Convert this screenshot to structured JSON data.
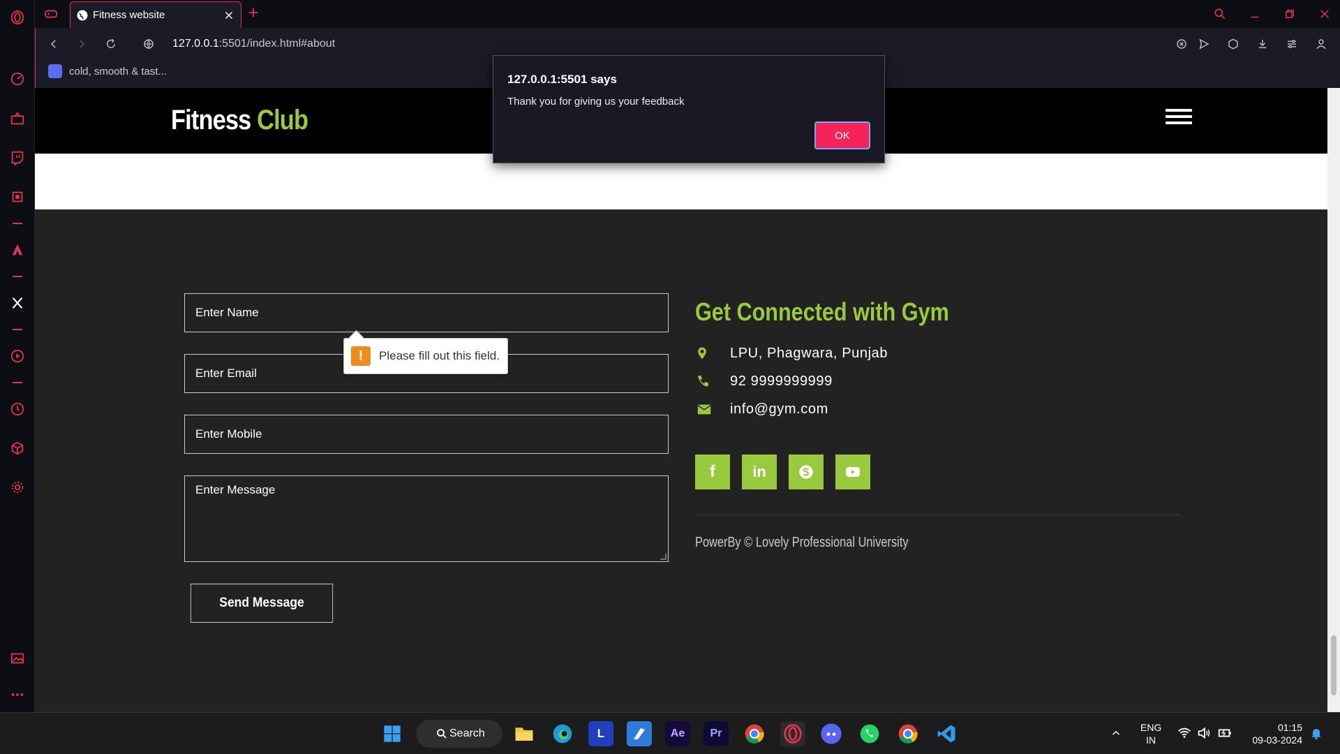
{
  "browser": {
    "tab_title": "Fitness website",
    "url_host": "127.0.0.1",
    "url_rest": ":5501/index.html#about",
    "bookmark_label": "cold, smooth & tast..."
  },
  "site": {
    "logo_part1": "Fitness ",
    "logo_part2": "Club",
    "form": {
      "name_placeholder": "Enter Name",
      "email_placeholder": "Enter Email",
      "mobile_placeholder": "Enter Mobile",
      "message_placeholder": "Enter Message",
      "send_label": "Send Message"
    },
    "validation_tooltip": "Please fill out this field.",
    "info": {
      "title": "Get Connected with Gym",
      "address": "LPU, Phagwara, Punjab",
      "phone": "92 9999999999",
      "email": "info@gym.com"
    },
    "socials": [
      "facebook",
      "linkedin",
      "skype",
      "youtube"
    ],
    "copyright": "PowerBy © Lovely Professional University"
  },
  "dialog": {
    "title": "127.0.0.1:5501 says",
    "message": "Thank you for giving us your feedback",
    "ok_label": "OK"
  },
  "taskbar": {
    "search_label": "Search",
    "lang_top": "ENG",
    "lang_bottom": "IN",
    "time": "01:15",
    "date": "09-03-2024"
  },
  "colors": {
    "accent": "#e0344f",
    "brand_green": "#99c93c",
    "ok_button": "#f4245a"
  }
}
